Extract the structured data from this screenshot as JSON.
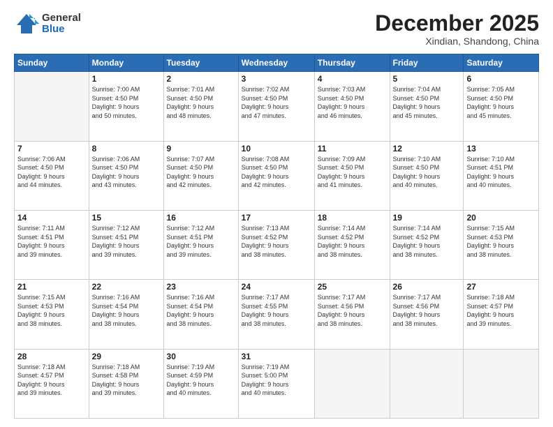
{
  "logo": {
    "general": "General",
    "blue": "Blue"
  },
  "header": {
    "month": "December 2025",
    "location": "Xindian, Shandong, China"
  },
  "weekdays": [
    "Sunday",
    "Monday",
    "Tuesday",
    "Wednesday",
    "Thursday",
    "Friday",
    "Saturday"
  ],
  "weeks": [
    [
      {
        "day": "",
        "info": ""
      },
      {
        "day": "1",
        "info": "Sunrise: 7:00 AM\nSunset: 4:50 PM\nDaylight: 9 hours\nand 50 minutes."
      },
      {
        "day": "2",
        "info": "Sunrise: 7:01 AM\nSunset: 4:50 PM\nDaylight: 9 hours\nand 48 minutes."
      },
      {
        "day": "3",
        "info": "Sunrise: 7:02 AM\nSunset: 4:50 PM\nDaylight: 9 hours\nand 47 minutes."
      },
      {
        "day": "4",
        "info": "Sunrise: 7:03 AM\nSunset: 4:50 PM\nDaylight: 9 hours\nand 46 minutes."
      },
      {
        "day": "5",
        "info": "Sunrise: 7:04 AM\nSunset: 4:50 PM\nDaylight: 9 hours\nand 45 minutes."
      },
      {
        "day": "6",
        "info": "Sunrise: 7:05 AM\nSunset: 4:50 PM\nDaylight: 9 hours\nand 45 minutes."
      }
    ],
    [
      {
        "day": "7",
        "info": "Sunrise: 7:06 AM\nSunset: 4:50 PM\nDaylight: 9 hours\nand 44 minutes."
      },
      {
        "day": "8",
        "info": "Sunrise: 7:06 AM\nSunset: 4:50 PM\nDaylight: 9 hours\nand 43 minutes."
      },
      {
        "day": "9",
        "info": "Sunrise: 7:07 AM\nSunset: 4:50 PM\nDaylight: 9 hours\nand 42 minutes."
      },
      {
        "day": "10",
        "info": "Sunrise: 7:08 AM\nSunset: 4:50 PM\nDaylight: 9 hours\nand 42 minutes."
      },
      {
        "day": "11",
        "info": "Sunrise: 7:09 AM\nSunset: 4:50 PM\nDaylight: 9 hours\nand 41 minutes."
      },
      {
        "day": "12",
        "info": "Sunrise: 7:10 AM\nSunset: 4:50 PM\nDaylight: 9 hours\nand 40 minutes."
      },
      {
        "day": "13",
        "info": "Sunrise: 7:10 AM\nSunset: 4:51 PM\nDaylight: 9 hours\nand 40 minutes."
      }
    ],
    [
      {
        "day": "14",
        "info": "Sunrise: 7:11 AM\nSunset: 4:51 PM\nDaylight: 9 hours\nand 39 minutes."
      },
      {
        "day": "15",
        "info": "Sunrise: 7:12 AM\nSunset: 4:51 PM\nDaylight: 9 hours\nand 39 minutes."
      },
      {
        "day": "16",
        "info": "Sunrise: 7:12 AM\nSunset: 4:51 PM\nDaylight: 9 hours\nand 39 minutes."
      },
      {
        "day": "17",
        "info": "Sunrise: 7:13 AM\nSunset: 4:52 PM\nDaylight: 9 hours\nand 38 minutes."
      },
      {
        "day": "18",
        "info": "Sunrise: 7:14 AM\nSunset: 4:52 PM\nDaylight: 9 hours\nand 38 minutes."
      },
      {
        "day": "19",
        "info": "Sunrise: 7:14 AM\nSunset: 4:52 PM\nDaylight: 9 hours\nand 38 minutes."
      },
      {
        "day": "20",
        "info": "Sunrise: 7:15 AM\nSunset: 4:53 PM\nDaylight: 9 hours\nand 38 minutes."
      }
    ],
    [
      {
        "day": "21",
        "info": "Sunrise: 7:15 AM\nSunset: 4:53 PM\nDaylight: 9 hours\nand 38 minutes."
      },
      {
        "day": "22",
        "info": "Sunrise: 7:16 AM\nSunset: 4:54 PM\nDaylight: 9 hours\nand 38 minutes."
      },
      {
        "day": "23",
        "info": "Sunrise: 7:16 AM\nSunset: 4:54 PM\nDaylight: 9 hours\nand 38 minutes."
      },
      {
        "day": "24",
        "info": "Sunrise: 7:17 AM\nSunset: 4:55 PM\nDaylight: 9 hours\nand 38 minutes."
      },
      {
        "day": "25",
        "info": "Sunrise: 7:17 AM\nSunset: 4:56 PM\nDaylight: 9 hours\nand 38 minutes."
      },
      {
        "day": "26",
        "info": "Sunrise: 7:17 AM\nSunset: 4:56 PM\nDaylight: 9 hours\nand 38 minutes."
      },
      {
        "day": "27",
        "info": "Sunrise: 7:18 AM\nSunset: 4:57 PM\nDaylight: 9 hours\nand 39 minutes."
      }
    ],
    [
      {
        "day": "28",
        "info": "Sunrise: 7:18 AM\nSunset: 4:57 PM\nDaylight: 9 hours\nand 39 minutes."
      },
      {
        "day": "29",
        "info": "Sunrise: 7:18 AM\nSunset: 4:58 PM\nDaylight: 9 hours\nand 39 minutes."
      },
      {
        "day": "30",
        "info": "Sunrise: 7:19 AM\nSunset: 4:59 PM\nDaylight: 9 hours\nand 40 minutes."
      },
      {
        "day": "31",
        "info": "Sunrise: 7:19 AM\nSunset: 5:00 PM\nDaylight: 9 hours\nand 40 minutes."
      },
      {
        "day": "",
        "info": ""
      },
      {
        "day": "",
        "info": ""
      },
      {
        "day": "",
        "info": ""
      }
    ]
  ]
}
